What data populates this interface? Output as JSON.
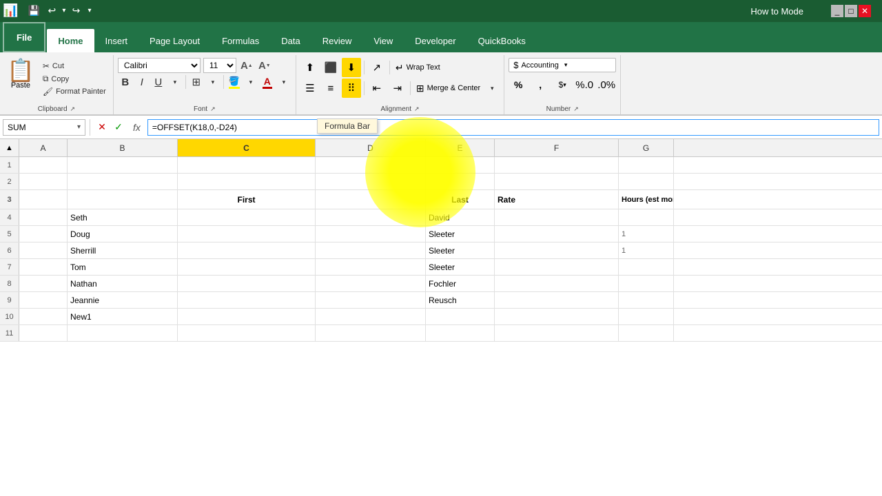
{
  "titlebar": {
    "title": "How to Mode"
  },
  "qat": {
    "save": "💾",
    "undo": "↩",
    "redo": "↪",
    "more": "▾"
  },
  "ribbon": {
    "tabs": [
      {
        "id": "file",
        "label": "File"
      },
      {
        "id": "home",
        "label": "Home",
        "active": true
      },
      {
        "id": "insert",
        "label": "Insert"
      },
      {
        "id": "pagelayout",
        "label": "Page Layout"
      },
      {
        "id": "formulas",
        "label": "Formulas"
      },
      {
        "id": "data",
        "label": "Data"
      },
      {
        "id": "review",
        "label": "Review"
      },
      {
        "id": "view",
        "label": "View"
      },
      {
        "id": "developer",
        "label": "Developer"
      },
      {
        "id": "quickbooks",
        "label": "QuickBooks"
      }
    ],
    "clipboard": {
      "paste_label": "Paste",
      "cut_label": "Cut",
      "copy_label": "Copy",
      "format_painter_label": "Format Painter",
      "group_label": "Clipboard"
    },
    "font": {
      "font_name": "Calibri",
      "font_size": "11",
      "bold": "B",
      "italic": "I",
      "underline": "U",
      "group_label": "Font"
    },
    "alignment": {
      "wrap_text": "Wrap Text",
      "merge_center": "Merge & Center",
      "group_label": "Alignment"
    },
    "number": {
      "accounting": "Accounting",
      "percent": "%",
      "comma": ",",
      "group_label": "Number"
    }
  },
  "formulabar": {
    "name_box": "SUM",
    "cancel": "✕",
    "confirm": "✓",
    "fx": "fx",
    "formula": "=OFFSET(K18,0,-D24)",
    "tooltip": "Formula Bar"
  },
  "columns": [
    "A",
    "B",
    "C",
    "D",
    "E",
    "F",
    "G"
  ],
  "rows": [
    {
      "num": 1,
      "cells": [
        "",
        "",
        "",
        "",
        "",
        "",
        ""
      ]
    },
    {
      "num": 2,
      "cells": [
        "",
        "",
        "",
        "",
        "",
        "",
        ""
      ]
    },
    {
      "num": 3,
      "cells": [
        "",
        "",
        "First",
        "",
        "Last",
        "Rate",
        "Hours (est monthly)"
      ]
    },
    {
      "num": 4,
      "cells": [
        "",
        "Seth",
        "",
        "",
        "David",
        "",
        ""
      ]
    },
    {
      "num": 5,
      "cells": [
        "",
        "Doug",
        "",
        "",
        "Sleeter",
        "",
        ""
      ]
    },
    {
      "num": 6,
      "cells": [
        "",
        "Sherrill",
        "",
        "",
        "Sleeter",
        "",
        ""
      ]
    },
    {
      "num": 7,
      "cells": [
        "",
        "Tom",
        "",
        "",
        "Sleeter",
        "",
        ""
      ]
    },
    {
      "num": 8,
      "cells": [
        "",
        "Nathan",
        "",
        "",
        "Fochler",
        "",
        ""
      ]
    },
    {
      "num": 9,
      "cells": [
        "",
        "Jeannie",
        "",
        "",
        "Reusch",
        "",
        ""
      ]
    },
    {
      "num": 10,
      "cells": [
        "",
        "New1",
        "",
        "",
        "",
        "",
        ""
      ]
    },
    {
      "num": 11,
      "cells": [
        "",
        "",
        "",
        "",
        "",
        "",
        ""
      ]
    }
  ]
}
